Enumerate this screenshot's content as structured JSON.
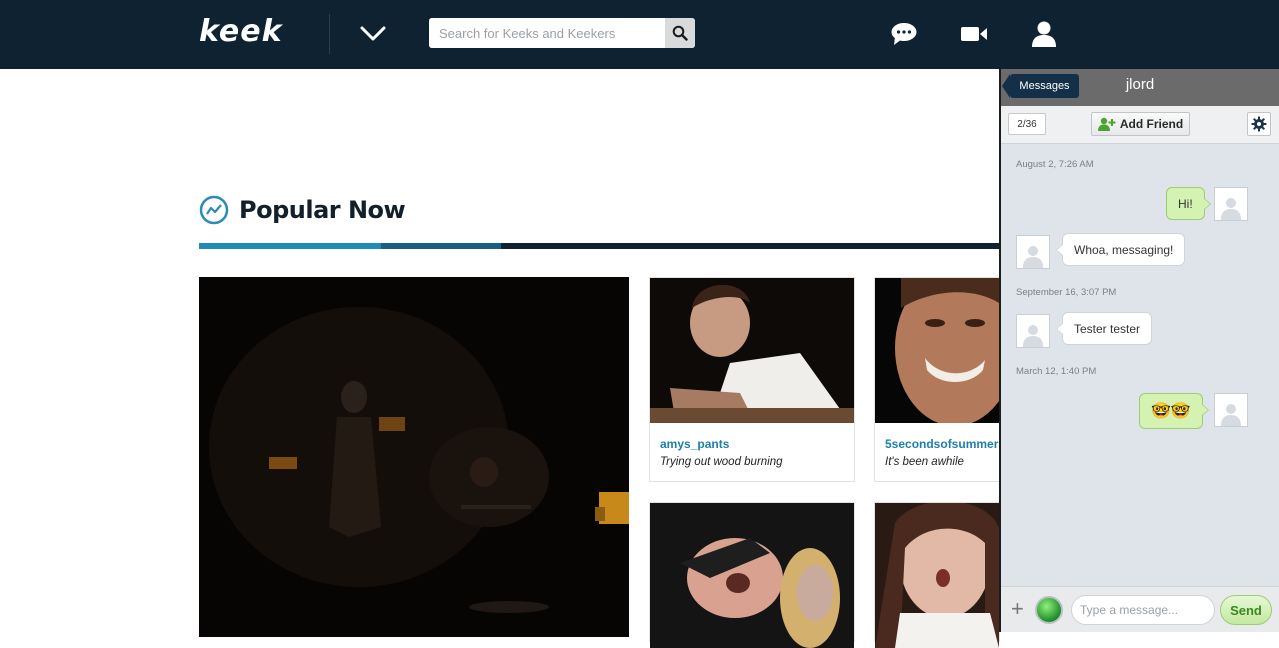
{
  "nav": {
    "logo": "keek",
    "search_placeholder": "Search for Keeks and Keekers",
    "icons": [
      "chevron-down-icon",
      "search-icon",
      "chat-bubble-icon",
      "video-camera-icon",
      "user-icon"
    ]
  },
  "main": {
    "section_title": "Popular Now",
    "cards": [
      {
        "user": "amys_pants",
        "caption": "Trying out wood burning"
      },
      {
        "user": "5secondsofsummer",
        "caption": "It's been awhile"
      }
    ]
  },
  "chat": {
    "back_label": "Messages",
    "contact_name": "jlord",
    "counter": "2/36",
    "add_friend_label": "Add Friend",
    "messages": [
      {
        "timestamp": "August 2, 7:26 AM"
      },
      {
        "text": "Hi!",
        "direction": "out"
      },
      {
        "text": "Whoa, messaging!",
        "direction": "in"
      },
      {
        "timestamp": "September 16, 3:07 PM"
      },
      {
        "text": "Tester tester",
        "direction": "in"
      },
      {
        "timestamp": "March 12, 1:40 PM"
      },
      {
        "text": "🤓🤓",
        "direction": "out"
      }
    ],
    "input_placeholder": "Type a message...",
    "send_label": "Send"
  },
  "colors": {
    "nav_bg": "#0f2232",
    "accent_blue": "#1f8bbb",
    "bubble_out": "#d4f2b2",
    "chat_bg": "#dfe4ea",
    "send_green": "#3a8a1f"
  }
}
